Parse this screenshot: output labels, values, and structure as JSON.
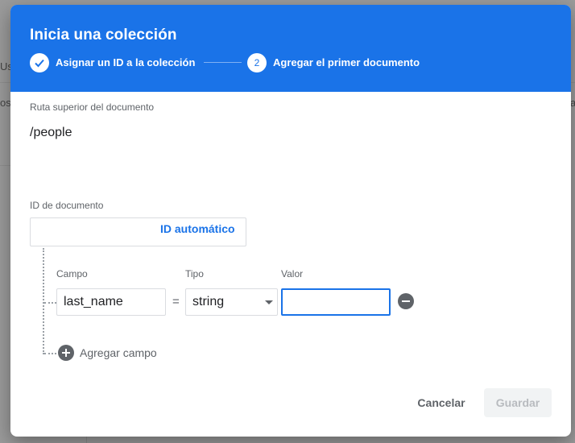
{
  "background": {
    "fragments": [
      "Us",
      "os",
      "a"
    ]
  },
  "dialog": {
    "title": "Inicia una colección",
    "steps": [
      {
        "label": "Asignar un ID a la colección",
        "state": "done"
      },
      {
        "number": "2",
        "label": "Agregar el primer documento",
        "state": "active"
      }
    ],
    "parent_path": {
      "label": "Ruta superior del documento",
      "value": "/people"
    },
    "document_id": {
      "label": "ID de documento",
      "value": "",
      "auto_id_label": "ID automático"
    },
    "fields": {
      "headers": {
        "name": "Campo",
        "type": "Tipo",
        "value": "Valor"
      },
      "rows": [
        {
          "name": "last_name",
          "type": "string",
          "value": ""
        }
      ],
      "equals": "=",
      "add_label": "Agregar campo"
    },
    "actions": {
      "cancel": "Cancelar",
      "save": "Guardar"
    }
  },
  "colors": {
    "header": "#1a73e8",
    "accent": "#1a73e8",
    "icon_gray": "#5f6368"
  }
}
